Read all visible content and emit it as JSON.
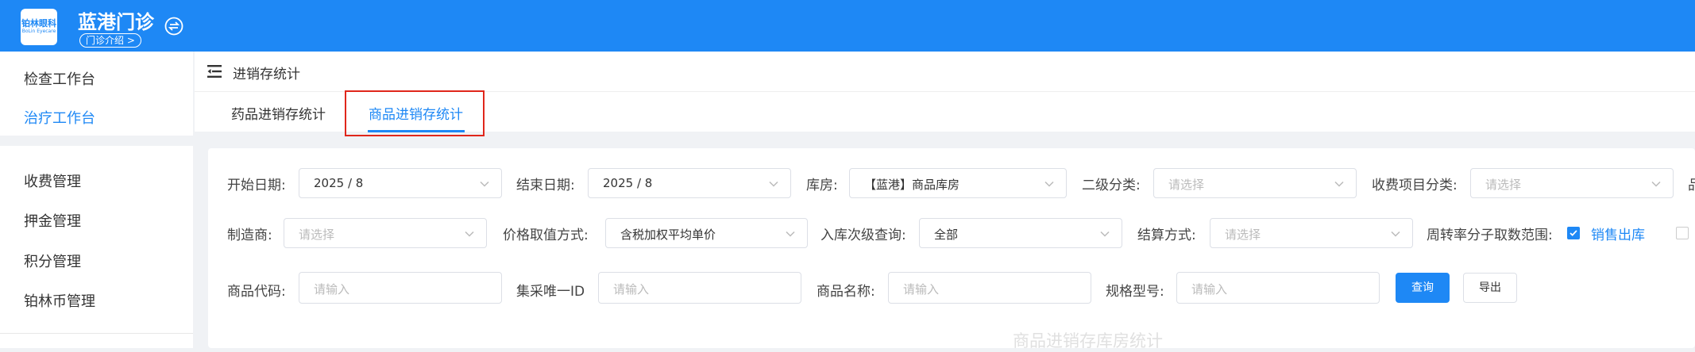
{
  "header": {
    "logo_line1": "铂林眼科",
    "logo_line2": "BoLin Eyecare",
    "clinic_name": "蓝港门诊",
    "clinic_intro": "门诊介绍 >"
  },
  "sidebar": {
    "items": [
      {
        "label": "检查工作台"
      },
      {
        "label": "治疗工作台"
      },
      {
        "label": "收费管理"
      },
      {
        "label": "押金管理"
      },
      {
        "label": "积分管理"
      },
      {
        "label": "铂林币管理"
      }
    ],
    "active_index": 1
  },
  "breadcrumb": {
    "label": "进销存统计"
  },
  "tabs": [
    {
      "label": "药品进销存统计"
    },
    {
      "label": "商品进销存统计"
    }
  ],
  "filters": {
    "row1": {
      "start_date": {
        "label": "开始日期:",
        "value": "2025 / 8"
      },
      "end_date": {
        "label": "结束日期:",
        "value": "2025 / 8"
      },
      "warehouse": {
        "label": "库房:",
        "value": "【蓝港】商品库房"
      },
      "category2": {
        "label": "二级分类:",
        "placeholder": "请选择"
      },
      "fee_category": {
        "label": "收费项目分类:",
        "placeholder": "请选择"
      },
      "cut_label": "品"
    },
    "row2": {
      "manufacturer": {
        "label": "制造商:",
        "placeholder": "请选择"
      },
      "price_method": {
        "label": "价格取值方式:",
        "value": "含税加权平均单价"
      },
      "inbound_level": {
        "label": "入库次级查询:",
        "value": "全部"
      },
      "settle_method": {
        "label": "结算方式:",
        "placeholder": "请选择"
      },
      "turnover": {
        "label": "周转率分子取数范围:",
        "option1": "销售出库"
      }
    },
    "row3": {
      "goods_code": {
        "label": "商品代码:",
        "placeholder": "请输入"
      },
      "vbp_id": {
        "label": "集采唯一ID",
        "placeholder": "请输入"
      },
      "goods_name": {
        "label": "商品名称:",
        "placeholder": "请输入"
      },
      "spec_model": {
        "label": "规格型号:",
        "placeholder": "请输入"
      },
      "query_button": "查询",
      "export_button": "导出"
    }
  },
  "section_title": "商品进销存库房统计",
  "colors": {
    "brand": "#1e88f5",
    "highlight_box": "#e0261b"
  }
}
